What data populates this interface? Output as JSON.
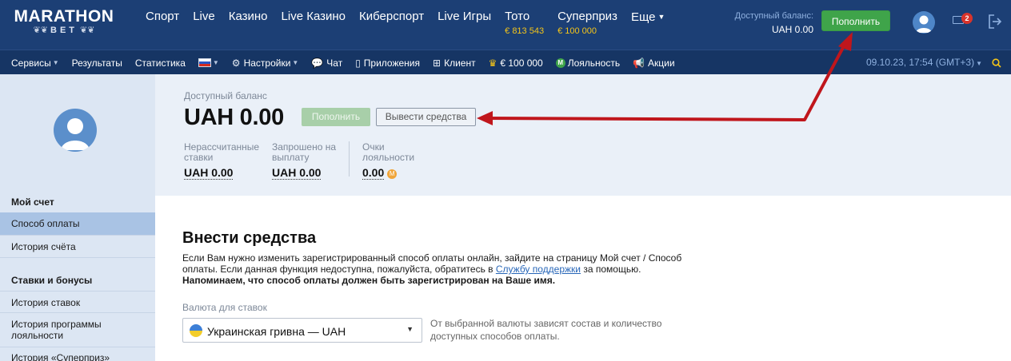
{
  "header": {
    "logo_line1": "MARATHON",
    "logo_line2": "BET",
    "nav": [
      {
        "label": "Спорт",
        "sub": ""
      },
      {
        "label": "Live",
        "sub": ""
      },
      {
        "label": "Казино",
        "sub": ""
      },
      {
        "label": "Live Казино",
        "sub": ""
      },
      {
        "label": "Киберспорт",
        "sub": ""
      },
      {
        "label": "Live Игры",
        "sub": ""
      },
      {
        "label": "Тото",
        "sub": "€ 813 543"
      },
      {
        "label": "Суперприз",
        "sub": "€ 100 000"
      },
      {
        "label": "Еще",
        "sub": ""
      }
    ],
    "balance_label": "Доступный баланс:",
    "balance_value": "UAH 0.00",
    "deposit_button": "Пополнить",
    "mail_count": "2"
  },
  "subnav": {
    "items": [
      {
        "label": "Сервисы"
      },
      {
        "label": "Результаты"
      },
      {
        "label": "Статистика"
      },
      {
        "label": ""
      },
      {
        "label": "Настройки"
      },
      {
        "label": "Чат"
      },
      {
        "label": "Приложения"
      },
      {
        "label": "Клиент"
      },
      {
        "label": "€ 100 000"
      },
      {
        "label": "Лояльность"
      },
      {
        "label": "Акции"
      }
    ],
    "datetime": "09.10.23, 17:54 (GMT+3)"
  },
  "sidebar": {
    "section1": "Мой счет",
    "items1": [
      "Способ оплаты",
      "История счёта"
    ],
    "section2": "Ставки и бонусы",
    "items2": [
      "История ставок",
      "История программы лояльности",
      "История «Суперприз»"
    ]
  },
  "balance": {
    "label": "Доступный баланс",
    "amount": "UAH 0.00",
    "deposit": "Пополнить",
    "withdraw": "Вывести средства",
    "stats": [
      {
        "label": "Нерассчитанные ставки",
        "value": "UAH 0.00"
      },
      {
        "label": "Запрошено на выплату",
        "value": "UAH 0.00"
      },
      {
        "label": "Очки лояльности",
        "value": "0.00"
      }
    ]
  },
  "deposit": {
    "title": "Внести средства",
    "desc_part1": "Если Вам нужно изменить зарегистрированный способ оплаты онлайн, зайдите на страницу Мой счет / Способ оплаты. Если данная функция недоступна, пожалуйста, обратитесь в ",
    "desc_link": "Службу поддержки",
    "desc_part2": " за помощью.",
    "desc_bold": "Напоминаем, что способ оплаты должен быть зарегистрирован на Ваше имя.",
    "currency_label": "Валюта для ставок",
    "currency_value": "Украинская гривна — UAH",
    "currency_note": "От выбранной валюты зависят состав и количество доступных способов оплаты."
  },
  "colors": {
    "header_bg": "#1c3f75",
    "subnav_bg": "#163564",
    "accent_green": "#3fa44a",
    "annotation_arrow": "#c0161c"
  }
}
